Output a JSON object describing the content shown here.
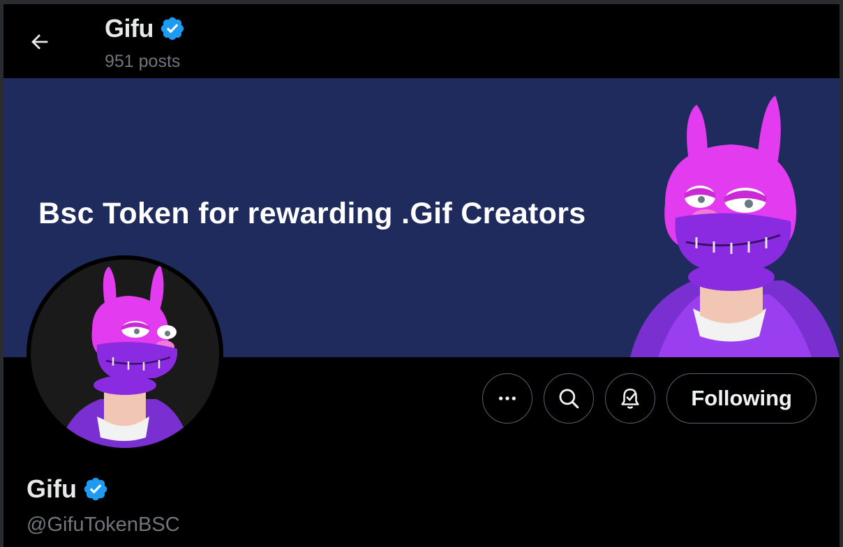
{
  "header": {
    "name": "Gifu",
    "posts": "951 posts"
  },
  "banner": {
    "text": "Bsc Token for rewarding .Gif Creators"
  },
  "actions": {
    "more_icon": "more-horizontal-icon",
    "search_icon": "search-icon",
    "notify_icon": "bell-check-icon",
    "following_label": "Following"
  },
  "profile": {
    "name": "Gifu",
    "handle": "@GifuTokenBSC"
  },
  "colors": {
    "background": "#000000",
    "banner": "#1f2b5c",
    "verified": "#1d9bf0",
    "text_primary": "#e7e9ea",
    "text_secondary": "#71767b",
    "mascot_pink": "#e33bf0",
    "mascot_purple": "#8a2be2"
  }
}
